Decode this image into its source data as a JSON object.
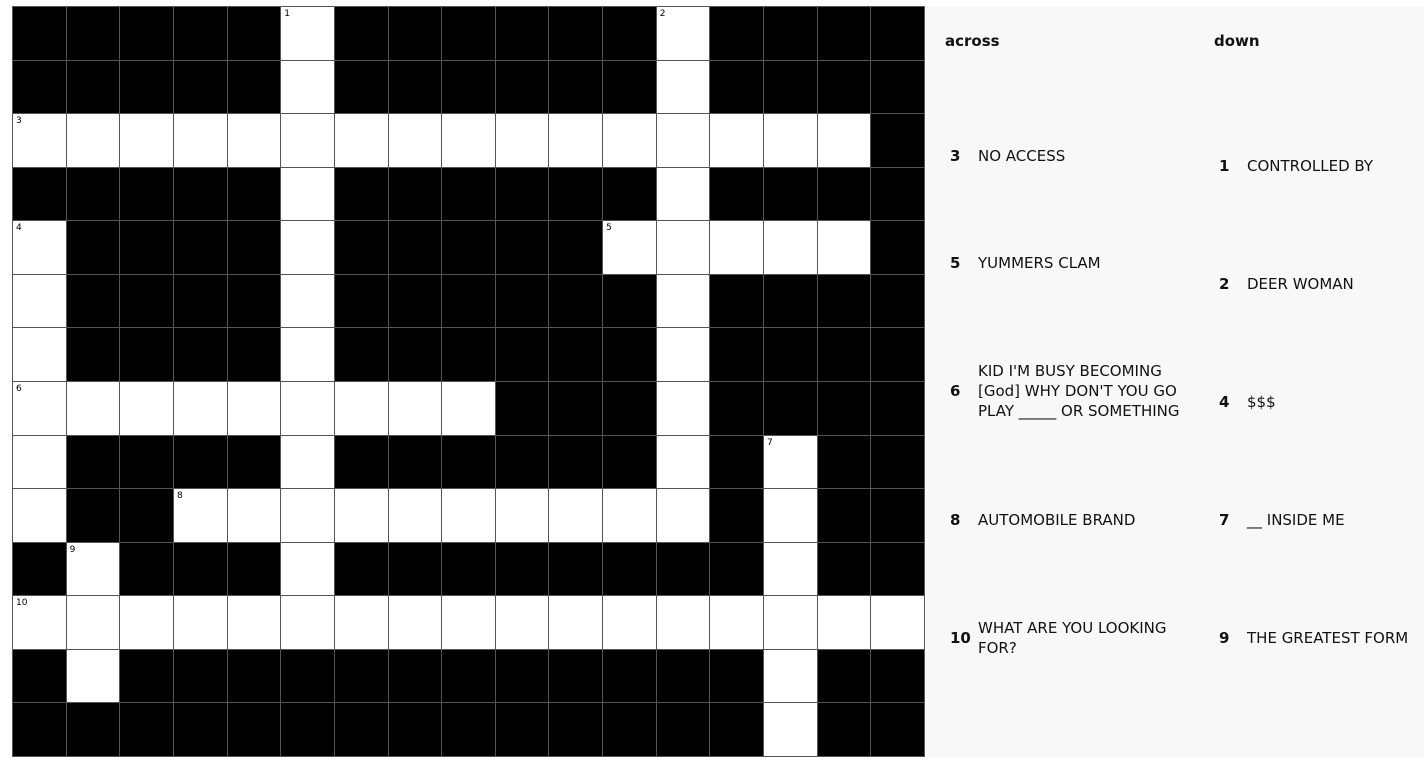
{
  "grid": {
    "rows": 14,
    "cols": 17,
    "cells": [
      "-----0------0----",
      "-----0------0----",
      "0000000000000000-",
      "-----0------0----",
      "0----0-----00000-",
      "0----0------0----",
      "0----0------0----",
      "000000000---0----",
      "0----0------0-0--",
      "0--0000000000-0--",
      "-0---0--------0--",
      "00000000000000000",
      "-0------------0--",
      "--------------0--"
    ],
    "numbers": [
      {
        "r": 0,
        "c": 5,
        "n": "1"
      },
      {
        "r": 0,
        "c": 12,
        "n": "2"
      },
      {
        "r": 2,
        "c": 0,
        "n": "3"
      },
      {
        "r": 4,
        "c": 0,
        "n": "4"
      },
      {
        "r": 4,
        "c": 11,
        "n": "5"
      },
      {
        "r": 7,
        "c": 0,
        "n": "6"
      },
      {
        "r": 8,
        "c": 14,
        "n": "7"
      },
      {
        "r": 9,
        "c": 3,
        "n": "8"
      },
      {
        "r": 10,
        "c": 1,
        "n": "9"
      },
      {
        "r": 11,
        "c": 0,
        "n": "10"
      }
    ]
  },
  "clues": {
    "across_label": "across",
    "down_label": "down",
    "across": [
      {
        "num": "3",
        "text": "NO ACCESS"
      },
      {
        "num": "5",
        "text": "YUMMERS CLAM"
      },
      {
        "num": "6",
        "text": "KID I'M BUSY BECOMING [God] WHY DON'T YOU GO PLAY _____ OR SOMETHING"
      },
      {
        "num": "8",
        "text": "AUTOMOBILE BRAND"
      },
      {
        "num": "10",
        "text": "WHAT ARE YOU LOOKING FOR?"
      }
    ],
    "down": [
      {
        "num": "1",
        "text": "CONTROLLED BY"
      },
      {
        "num": "2",
        "text": "DEER WOMAN"
      },
      {
        "num": "4",
        "text": "$$$"
      },
      {
        "num": "7",
        "text": "__ INSIDE ME"
      },
      {
        "num": "9",
        "text": "THE GREATEST FORM"
      }
    ]
  },
  "colors": {
    "block": "#000000",
    "open": "#ffffff",
    "gridline": "#555555",
    "panel": "#f8f8f8"
  }
}
